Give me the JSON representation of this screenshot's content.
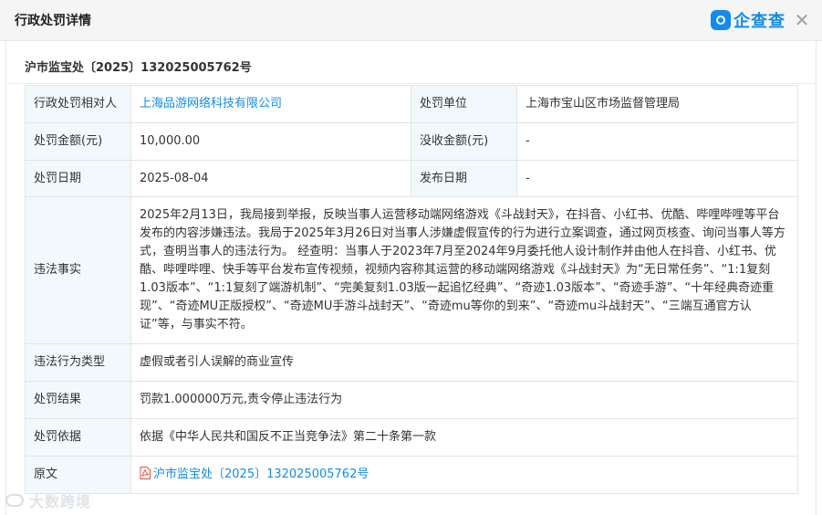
{
  "header": {
    "title": "行政处罚详情",
    "brand": "企查查",
    "close_glyph": "✕",
    "brand_color": "#128bed"
  },
  "document": {
    "title": "沪市监宝处〔2025〕132025005762号"
  },
  "rows": {
    "party_label": "行政处罚相对人",
    "party_value": "上海品游网络科技有限公司",
    "authority_label": "处罚单位",
    "authority_value": "上海市宝山区市场监督管理局",
    "amount_label": "处罚金额(元)",
    "amount_value": "10,000.00",
    "confiscation_label": "没收金额(元)",
    "confiscation_value": "-",
    "date_label": "处罚日期",
    "date_value": "2025-08-04",
    "publish_label": "发布日期",
    "publish_value": "-",
    "facts_label": "违法事实",
    "facts_value": "2025年2月13日，我局接到举报，反映当事人运营移动端网络游戏《斗战封天》，在抖音、小红书、优酷、哔哩哔哩等平台发布的内容涉嫌违法。我局于2025年3月26日对当事人涉嫌虚假宣传的行为进行立案调查，通过网页核查、询问当事人等方式，查明当事人的违法行为。 经查明：当事人于2023年7月至2024年9月委托他人设计制作并由他人在抖音、小红书、优酷、哔哩哔哩、快手等平台发布宣传视频，视频内容称其运营的移动端网络游戏《斗战封天》为“无日常任务”、“1:1复刻1.03版本”、“1:1复刻了端游机制”、“完美复刻1.03版一起追忆经典”、“奇迹1.03版本”、“奇迹手游”、“十年经典奇迹重现”、“奇迹MU正版授权”、“奇迹MU手游斗战封天”、“奇迹mu等你的到来”、“奇迹mu斗战封天”、“三端互通官方认证”等，与事实不符。",
    "type_label": "违法行为类型",
    "type_value": "虚假或者引人误解的商业宣传",
    "result_label": "处罚结果",
    "result_value": "罚款1.000000万元,责令停止违法行为",
    "basis_label": "处罚依据",
    "basis_value": "依据《中华人民共和国反不正当竞争法》第二十条第一款",
    "original_label": "原文",
    "original_value": "沪市监宝处〔2025〕132025005762号"
  },
  "watermark": {
    "text": "大数跨境"
  }
}
